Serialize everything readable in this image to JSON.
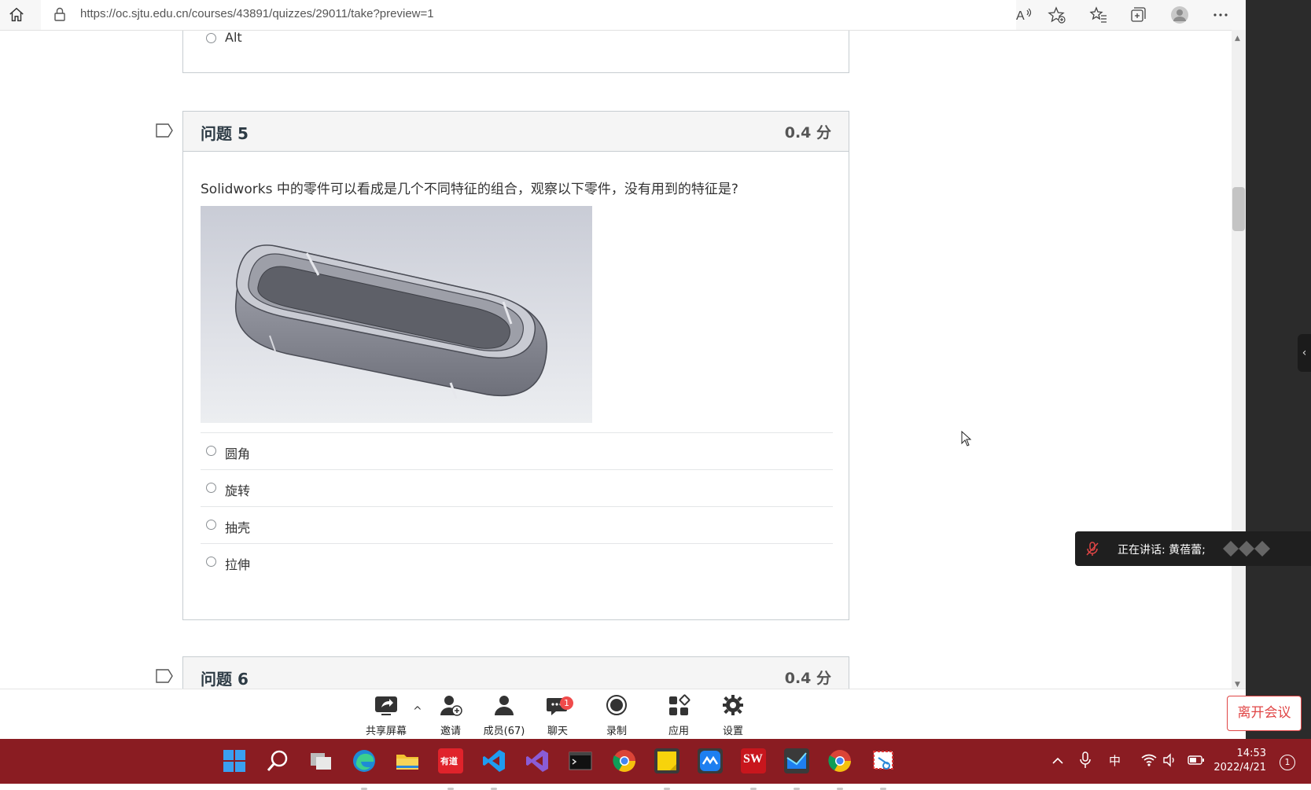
{
  "browser": {
    "url": "https://oc.sjtu.edu.cn/courses/43891/quizzes/29011/take?preview=1"
  },
  "quiz": {
    "prev_answer_label": "Alt",
    "question5": {
      "title": "问题 5",
      "points": "0.4 分",
      "text": "Solidworks 中的零件可以看成是几个不同特征的组合，观察以下零件，没有用到的特征是?",
      "answers": [
        "圆角",
        "旋转",
        "抽壳",
        "拉伸"
      ]
    },
    "question6": {
      "title": "问题 6",
      "points": "0.4 分"
    }
  },
  "meeting": {
    "tools": {
      "share": "共享屏幕",
      "invite": "邀请",
      "members": "成员(67)",
      "chat": "聊天",
      "chat_badge": "1",
      "record": "录制",
      "apps": "应用",
      "settings": "设置"
    },
    "leave_button": "离开会议",
    "speaking": "正在讲话: 黄蓓蕾;"
  },
  "taskbar": {
    "tray_ime": "中",
    "time": "14:53",
    "date": "2022/4/21",
    "notification_count": "1",
    "youdao_label": "有道",
    "sw_label": "SW"
  },
  "colors": {
    "taskbar": "#8a1c22",
    "leave": "#e04545",
    "badge": "#f04b4b"
  }
}
